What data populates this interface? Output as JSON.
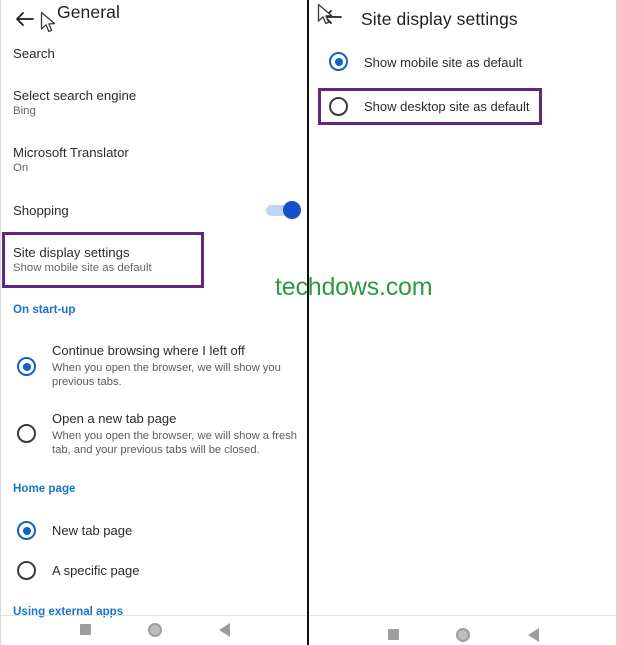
{
  "watermark": "techdows.com",
  "accent_blue": "#1460c8",
  "section_blue": "#1a73c8",
  "highlight_purple": "#63267e",
  "watermark_green": "#2e9a40",
  "left_panel": {
    "title": "General",
    "back_icon": "back-arrow-icon",
    "items": [
      {
        "title": "Search",
        "sub": ""
      },
      {
        "title": "Select search engine",
        "sub": "Bing"
      },
      {
        "title": "Microsoft Translator",
        "sub": "On"
      },
      {
        "title": "Shopping",
        "sub": ""
      },
      {
        "title": "Site display settings",
        "sub": "Show mobile site as default"
      }
    ],
    "shopping_toggle": {
      "state": "on",
      "label": "Shopping"
    },
    "sections": [
      {
        "header": "On start-up"
      },
      {
        "header": "Home page"
      },
      {
        "header": "Using external apps"
      }
    ],
    "startup_options": [
      {
        "label": "Continue browsing where I left off",
        "desc": "When you open the browser, we will show you previous tabs.",
        "selected": true
      },
      {
        "label": "Open a new tab page",
        "desc": "When you open the browser, we will show a fresh tab, and your previous tabs will be closed.",
        "selected": false
      }
    ],
    "homepage_options": [
      {
        "label": "New tab page",
        "selected": true
      },
      {
        "label": "A specific page",
        "selected": false
      }
    ],
    "navbar": {
      "recents": "square-recents-icon",
      "home": "circle-home-icon",
      "back": "triangle-back-icon"
    }
  },
  "right_panel": {
    "title": "Site display settings",
    "back_icon": "back-arrow-icon",
    "options": [
      {
        "label": "Show mobile site as default",
        "selected": true
      },
      {
        "label": "Show desktop site as default",
        "selected": false
      }
    ],
    "navbar": {
      "recents": "square-recents-icon",
      "home": "circle-home-icon",
      "back": "triangle-back-icon"
    }
  }
}
